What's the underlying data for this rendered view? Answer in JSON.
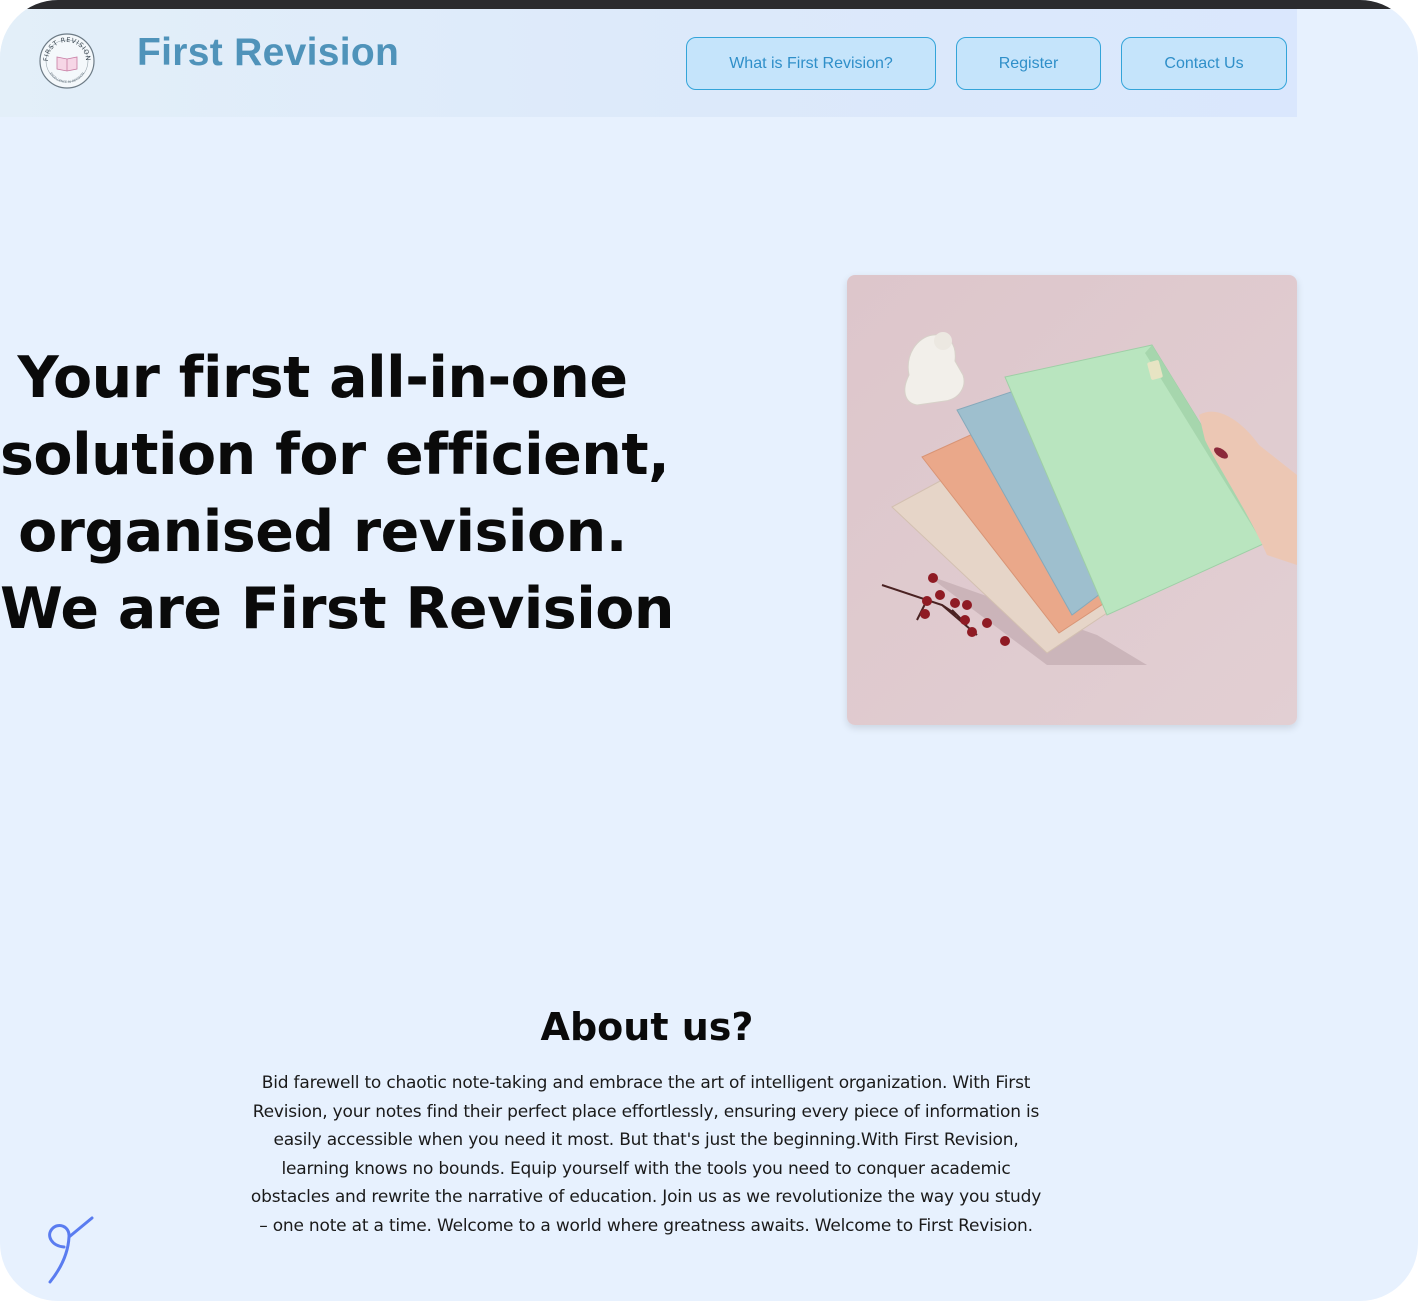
{
  "header": {
    "brand": "First Revision",
    "logo_text": "FIRST REVISION",
    "logo_subtext": "EXCELLENCE IN REVISION",
    "nav": [
      {
        "label": "What is First Revision?"
      },
      {
        "label": "Register"
      },
      {
        "label": "Contact Us"
      }
    ]
  },
  "hero": {
    "title_lines": [
      "Your first all-in-one",
      "solution for efficient,",
      "organised revision.",
      "We are First Revision"
    ]
  },
  "about": {
    "title": "About us?",
    "body": "Bid farewell to chaotic note-taking and embrace the art of intelligent organization. With First Revision, your notes find their perfect place effortlessly, ensuring every piece of information is easily accessible when you need it most. But that's just the beginning.With First Revision, learning knows no bounds. Equip yourself with the tools you need to conquer academic obstacles and rewrite the narrative of education. Join us as we revolutionize the way you study – one note at a time. Welcome to a world where greatness awaits. Welcome to First Revision."
  },
  "colors": {
    "page_bg": "#e7f1fe",
    "brand": "#4f93ba",
    "button_bg": "#c5e4fb",
    "button_border": "#33a4d9",
    "button_text": "#2f8fc9"
  }
}
